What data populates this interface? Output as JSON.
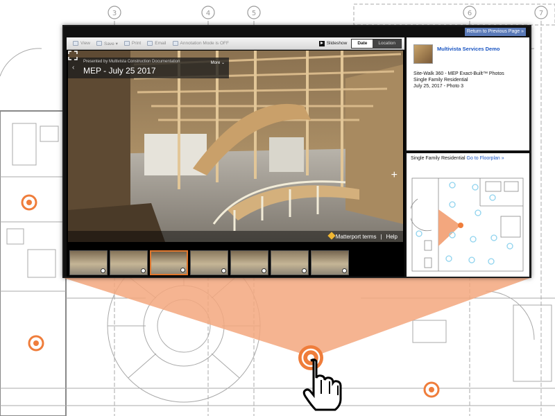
{
  "top_link": "Return to Previous Page »",
  "toolbar": {
    "items": [
      {
        "label": "View",
        "icon": "view-icon"
      },
      {
        "label": "Save ▾",
        "icon": "save-icon"
      },
      {
        "label": "Print",
        "icon": "print-icon"
      },
      {
        "label": "Email",
        "icon": "email-icon"
      },
      {
        "label": "Annotation Mode is OFF",
        "icon": "annotation-icon"
      }
    ],
    "slideshow": "Slideshow",
    "sort_date": "Date",
    "sort_location": "Location"
  },
  "caption": {
    "presented_by": "Presented by Multivista Construction Documentation",
    "title": "MEP - July 25 2017",
    "more": "More ⌄"
  },
  "photo_footer": {
    "terms": "Matterport terms",
    "separator": "|",
    "help": "Help"
  },
  "thumbnails": [
    {
      "id": 1,
      "selected": false
    },
    {
      "id": 2,
      "selected": false
    },
    {
      "id": 3,
      "selected": true
    },
    {
      "id": 4,
      "selected": false
    },
    {
      "id": 5,
      "selected": false
    },
    {
      "id": 6,
      "selected": false
    },
    {
      "id": 7,
      "selected": false
    }
  ],
  "info": {
    "org": "Multivista Services Demo",
    "line1": "Site-Walk 360 - MEP Exact-Built™ Photos",
    "line2": "Single Family Residential",
    "line3": "July 25, 2017 - Photo 3"
  },
  "map": {
    "title": "Single Family Residential",
    "link": "Go to Floorplan »"
  },
  "colors": {
    "accent_orange": "#ef7d3b",
    "link_blue": "#1a55c2",
    "blueprint_line": "#9a9a9a",
    "marker_blue": "#8fd3ee"
  }
}
